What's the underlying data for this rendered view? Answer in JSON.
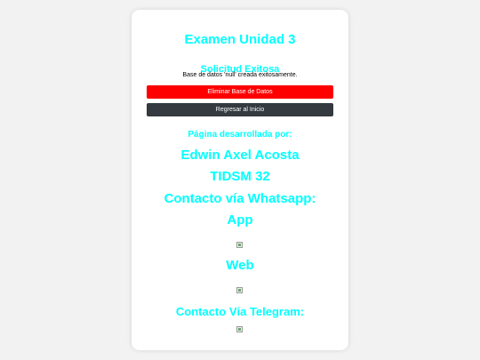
{
  "card": {
    "title": "Examen Unidad 3",
    "subtitle": "Solicitud Exitosa",
    "message": "Base de datos 'null' creada exitosamente.",
    "delete_button": "Eliminar Base de Datos",
    "home_button": "Regresar al Inicio",
    "developed_by": "Página desarrollada por:",
    "author": "Edwin Axel Acosta",
    "group": "TIDSM 32",
    "whatsapp_heading": "Contacto vía Whatsapp:",
    "app_label": "App",
    "web_label": "Web",
    "telegram_heading": "Contacto Vía Telegram:"
  },
  "colors": {
    "accent_text": "#00ffff",
    "danger_button": "#ff0000",
    "dark_button": "#343a40",
    "background": "#f2f2f2"
  }
}
